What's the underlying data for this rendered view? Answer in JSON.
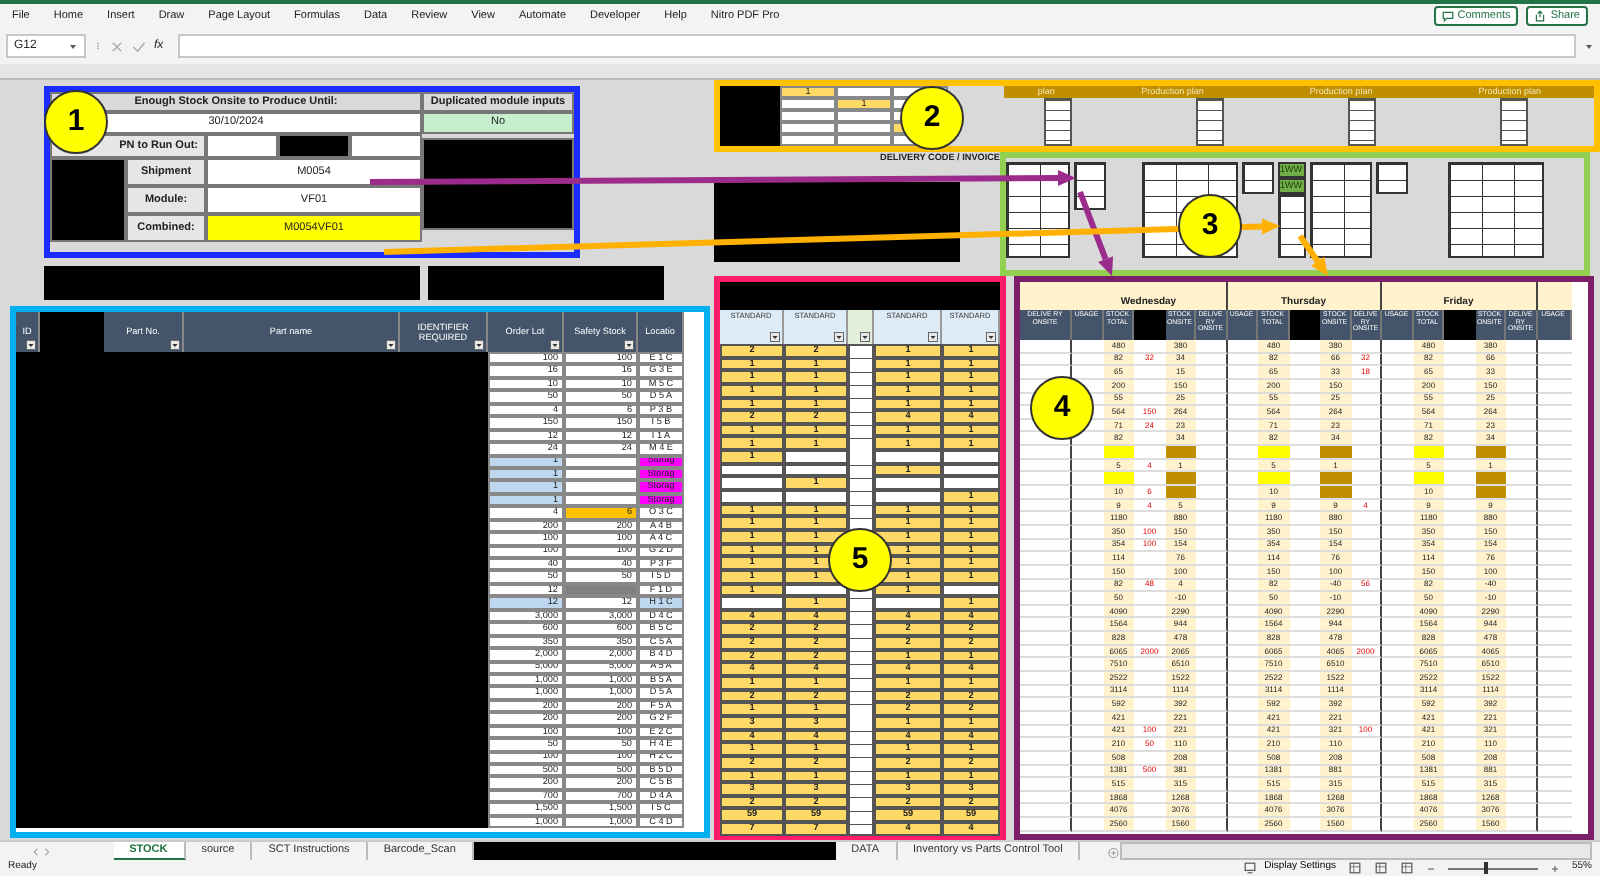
{
  "menu": [
    "File",
    "Home",
    "Insert",
    "Draw",
    "Page Layout",
    "Formulas",
    "Data",
    "Review",
    "View",
    "Automate",
    "Developer",
    "Help",
    "Nitro PDF Pro"
  ],
  "header_buttons": [
    "Comments",
    "Share"
  ],
  "formula_bar": {
    "name_box": "G12",
    "fx": "fx"
  },
  "summary": {
    "title": "Enough Stock Onsite to Produce Until:",
    "date": "30/10/2024",
    "dup_title": "Duplicated module inputs",
    "dup_value": "No",
    "run_out_label": "PN to Run Out:",
    "fields": [
      {
        "label": "Shipment",
        "value": "M0054",
        "highlight": false
      },
      {
        "label": "Module:",
        "value": "VF01",
        "highlight": false
      },
      {
        "label": "Combined:",
        "value": "M0054VF01",
        "highlight": true
      }
    ]
  },
  "plan": {
    "mini_grid": [
      [
        {
          "filled": true,
          "text": "1"
        },
        {
          "filled": false
        },
        {
          "filled": false
        }
      ],
      [
        {
          "filled": false
        },
        {
          "filled": true,
          "text": "1"
        },
        {
          "filled": false
        }
      ],
      [
        {
          "filled": false
        },
        {
          "filled": false
        },
        {
          "filled": false
        }
      ],
      [
        {
          "filled": false
        },
        {
          "filled": false
        },
        {
          "filled": true
        }
      ],
      [
        {
          "filled": false
        },
        {
          "filled": false
        },
        {
          "filled": false
        }
      ]
    ],
    "headers": [
      "plan",
      "Production plan",
      "Production plan",
      "Production plan"
    ]
  },
  "delivery_code_label": "DELIVERY CODE / INVOICE",
  "allocation": {
    "tags": [
      "1WW",
      "1WW"
    ]
  },
  "stock_table": {
    "columns": [
      {
        "kind": "header",
        "label": "ID",
        "filter": true
      },
      {
        "kind": "redacted",
        "filter": false
      },
      {
        "kind": "header",
        "label": "Part No.",
        "filter": true
      },
      {
        "kind": "header",
        "label": "Part name",
        "filter": true
      },
      {
        "kind": "header",
        "label": "IDENTIFIER REQUIRED",
        "filter": true
      },
      {
        "kind": "header",
        "label": "Order Lot",
        "filter": true
      },
      {
        "kind": "header",
        "label": "Safety Stock",
        "filter": true
      },
      {
        "kind": "header",
        "label": "Locatio",
        "filter": false
      }
    ],
    "rows": [
      [
        "100",
        "100",
        "E 1 C"
      ],
      [
        "16",
        "16",
        "G 3 E"
      ],
      [
        "10",
        "10",
        "M 5 C"
      ],
      [
        "50",
        "50",
        "D 5 A"
      ],
      [
        "4",
        "6",
        "P 3 B"
      ],
      [
        "150",
        "150",
        "I 5 B"
      ],
      [
        "12",
        "12",
        "I 1 A"
      ],
      [
        "24",
        "24",
        "M 4 E"
      ],
      [
        {
          "text": "1",
          "color": "#bdd7ee"
        },
        "",
        {
          "text": "Storag",
          "color": "#ff00ff"
        }
      ],
      [
        {
          "text": "1",
          "color": "#bdd7ee"
        },
        "",
        {
          "text": "Storag",
          "color": "#ff00ff"
        }
      ],
      [
        {
          "text": "1",
          "color": "#bdd7ee"
        },
        "",
        {
          "text": "Storag",
          "color": "#ff00ff"
        }
      ],
      [
        {
          "text": "1",
          "color": "#bdd7ee"
        },
        "",
        {
          "text": "Storag",
          "color": "#ff00ff"
        }
      ],
      [
        "4",
        {
          "text": "6",
          "color": "#ffc000"
        },
        "O 3 C"
      ],
      [
        "200",
        "200",
        "A 4 B"
      ],
      [
        "100",
        "100",
        "A 4 C"
      ],
      [
        "100",
        "100",
        "G 2 D"
      ],
      [
        "40",
        "40",
        "P 3 F"
      ],
      [
        "50",
        "50",
        "I 5 D"
      ],
      [
        "12",
        {
          "text": "",
          "color": "#808080"
        },
        "F 1 D"
      ],
      [
        {
          "text": "12",
          "color": "#bdd7ee"
        },
        "12",
        {
          "text": "H 1 C",
          "color": "#bdd7ee"
        }
      ],
      [
        "3,000",
        "3,000",
        "D 4 C"
      ],
      [
        "600",
        "600",
        "B 5 C"
      ],
      [
        "350",
        "350",
        "C 5 A"
      ],
      [
        "2,000",
        "2,000",
        "B 4 D"
      ],
      [
        "5,000",
        "5,000",
        "A 5 A"
      ],
      [
        "1,000",
        "1,000",
        "B 5 A"
      ],
      [
        "1,000",
        "1,000",
        "D 5 A"
      ],
      [
        "200",
        "200",
        "F 5 A"
      ],
      [
        "200",
        "200",
        "G 2 F"
      ],
      [
        "100",
        "100",
        "E 2 C"
      ],
      [
        "50",
        "50",
        "H 4 E"
      ],
      [
        "100",
        "100",
        "H 2 C"
      ],
      [
        "500",
        "500",
        "B 5 D"
      ],
      [
        "200",
        "200",
        "C 5 B"
      ],
      [
        "700",
        "700",
        "D 4 A"
      ],
      [
        "1,500",
        "1,500",
        "I 5 C"
      ],
      [
        "1,000",
        "1,000",
        "C 4 D"
      ]
    ]
  },
  "standard_table": {
    "columns": [
      {
        "kind": "header",
        "label": "STANDARD"
      },
      {
        "kind": "header",
        "label": "STANDARD"
      },
      {
        "kind": "blank"
      },
      {
        "kind": "header",
        "label": "STANDARD"
      },
      {
        "kind": "header",
        "label": "STANDARD"
      }
    ],
    "rows": [
      [
        "2",
        "2",
        "",
        "1",
        "1"
      ],
      [
        "1",
        "1",
        "",
        "1",
        "1"
      ],
      [
        "1",
        "1",
        "",
        "1",
        "1"
      ],
      [
        "1",
        "1",
        "",
        "1",
        "1"
      ],
      [
        "1",
        "1",
        "",
        "1",
        "1"
      ],
      [
        "2",
        "2",
        "",
        "4",
        "4"
      ],
      [
        "1",
        "1",
        "",
        "1",
        "1"
      ],
      [
        "1",
        "1",
        "",
        "1",
        "1"
      ],
      [
        "1",
        "",
        "",
        "",
        ""
      ],
      [
        "",
        "",
        "",
        "1",
        ""
      ],
      [
        "",
        "1",
        "",
        "",
        ""
      ],
      [
        "",
        "",
        "",
        "",
        "1"
      ],
      [
        "1",
        "1",
        "",
        "1",
        "1"
      ],
      [
        "1",
        "1",
        "",
        "1",
        "1"
      ],
      [
        "1",
        "1",
        "",
        "1",
        "1"
      ],
      [
        "1",
        "1",
        "",
        "1",
        "1"
      ],
      [
        "1",
        "1",
        "",
        "1",
        "1"
      ],
      [
        "1",
        "1",
        "",
        "1",
        "1"
      ],
      [
        "1",
        "",
        "",
        "1",
        ""
      ],
      [
        "",
        "1",
        "",
        "",
        "1"
      ],
      [
        "4",
        "4",
        "",
        "4",
        "4"
      ],
      [
        "2",
        "2",
        "",
        "2",
        "2"
      ],
      [
        "2",
        "2",
        "",
        "2",
        "2"
      ],
      [
        "2",
        "2",
        "",
        "1",
        "1"
      ],
      [
        "4",
        "4",
        "",
        "4",
        "4"
      ],
      [
        "1",
        "1",
        "",
        "1",
        "1"
      ],
      [
        "2",
        "2",
        "",
        "2",
        "2"
      ],
      [
        "1",
        "1",
        "",
        "2",
        "2"
      ],
      [
        "3",
        "3",
        "",
        "1",
        "1"
      ],
      [
        "4",
        "4",
        "",
        "4",
        "4"
      ],
      [
        "1",
        "1",
        "",
        "1",
        "1"
      ],
      [
        "2",
        "2",
        "",
        "2",
        "2"
      ],
      [
        "1",
        "1",
        "",
        "1",
        "1"
      ],
      [
        "3",
        "3",
        "",
        "3",
        "3"
      ],
      [
        "2",
        "2",
        "",
        "2",
        "2"
      ],
      [
        "59",
        "59",
        "",
        "59",
        "59"
      ],
      [
        "7",
        "7",
        "",
        "4",
        "4"
      ]
    ]
  },
  "schedule": {
    "lead_columns": [
      {
        "kind": "header",
        "label": "DELIVE RY ONSITE"
      }
    ],
    "days": [
      {
        "name": "Wednesday",
        "columns": [
          {
            "kind": "header",
            "label": "USAGE"
          },
          {
            "kind": "header",
            "label": "STOCK TOTAL"
          },
          {
            "kind": "redacted"
          },
          {
            "kind": "header",
            "label": "STOCK ONSITE"
          },
          {
            "kind": "header",
            "label": "DELIVE RY ONSITE"
          }
        ]
      },
      {
        "name": "Thursday",
        "columns": [
          {
            "kind": "header",
            "label": "USAGE"
          },
          {
            "kind": "header",
            "label": "STOCK TOTAL"
          },
          {
            "kind": "redacted"
          },
          {
            "kind": "header",
            "label": "STOCK ONSITE"
          },
          {
            "kind": "header",
            "label": "DELIVE RY ONSITE"
          }
        ]
      },
      {
        "name": "Friday",
        "columns": [
          {
            "kind": "header",
            "label": "USAGE"
          },
          {
            "kind": "header",
            "label": "STOCK TOTAL"
          },
          {
            "kind": "redacted"
          },
          {
            "kind": "header",
            "label": "STOCK ONSITE"
          },
          {
            "kind": "header",
            "label": "DELIVE RY ONSITE"
          }
        ]
      }
    ],
    "trail_columns": [
      {
        "kind": "header",
        "label": "USAGE"
      }
    ],
    "rows": [
      [
        "",
        "480",
        "",
        "380",
        "",
        "",
        "480",
        "",
        "380",
        "",
        "",
        "480",
        "",
        "380",
        ""
      ],
      [
        "",
        "82",
        "32",
        "34",
        "",
        "",
        "82",
        "",
        "66",
        "32",
        "",
        "82",
        "",
        "66",
        ""
      ],
      [
        "",
        "65",
        "",
        "15",
        "",
        "",
        "65",
        "",
        "33",
        "18",
        "",
        "65",
        "",
        "33",
        ""
      ],
      [
        "",
        "200",
        "",
        "150",
        "",
        "",
        "200",
        "",
        "150",
        "",
        "",
        "200",
        "",
        "150",
        ""
      ],
      [
        "",
        "55",
        "",
        "25",
        "",
        "",
        "55",
        "",
        "25",
        "",
        "",
        "55",
        "",
        "25",
        ""
      ],
      [
        "",
        "564",
        "150",
        "264",
        "",
        "",
        "564",
        "",
        "264",
        "",
        "",
        "564",
        "",
        "264",
        ""
      ],
      [
        "",
        "71",
        "24",
        "23",
        "",
        "",
        "71",
        "",
        "23",
        "",
        "",
        "71",
        "",
        "23",
        ""
      ],
      [
        "",
        "82",
        "",
        "34",
        "",
        "",
        "82",
        "",
        "34",
        "",
        "",
        "82",
        "",
        "34",
        ""
      ],
      [
        "",
        {
          "text": "",
          "color": "#ffff00"
        },
        "",
        {
          "text": "",
          "color": "#bf8f00"
        },
        "",
        "",
        {
          "text": "",
          "color": "#ffff00"
        },
        "",
        {
          "text": "",
          "color": "#bf8f00"
        },
        "",
        "",
        {
          "text": "",
          "color": "#ffff00"
        },
        "",
        {
          "text": "",
          "color": "#bf8f00"
        },
        ""
      ],
      [
        "",
        "5",
        "4",
        "1",
        "",
        "",
        "5",
        "",
        "1",
        "",
        "",
        "5",
        "",
        "1",
        ""
      ],
      [
        "",
        {
          "text": "",
          "color": "#ffff00"
        },
        "",
        {
          "text": "",
          "color": "#bf8f00"
        },
        "",
        "",
        {
          "text": "",
          "color": "#ffff00"
        },
        "",
        {
          "text": "",
          "color": "#bf8f00"
        },
        "",
        "",
        {
          "text": "",
          "color": "#ffff00"
        },
        "",
        {
          "text": "",
          "color": "#bf8f00"
        },
        ""
      ],
      [
        "",
        "10",
        "6",
        {
          "text": "",
          "color": "#bf8f00"
        },
        "",
        "",
        "10",
        "",
        {
          "text": "",
          "color": "#bf8f00"
        },
        "",
        "",
        "10",
        "",
        {
          "text": "",
          "color": "#bf8f00"
        },
        ""
      ],
      [
        "",
        "9",
        "4",
        "5",
        "",
        "",
        "9",
        "",
        "9",
        "4",
        "",
        "9",
        "",
        "9",
        ""
      ],
      [
        "",
        "1180",
        "",
        "880",
        "",
        "",
        "1180",
        "",
        "880",
        "",
        "",
        "1180",
        "",
        "880",
        ""
      ],
      [
        "",
        "350",
        "100",
        "150",
        "",
        "",
        "350",
        "",
        "150",
        "",
        "",
        "350",
        "",
        "150",
        ""
      ],
      [
        "",
        "354",
        "100",
        "154",
        "",
        "",
        "354",
        "",
        "154",
        "",
        "",
        "354",
        "",
        "154",
        ""
      ],
      [
        "",
        "114",
        "",
        "76",
        "",
        "",
        "114",
        "",
        "76",
        "",
        "",
        "114",
        "",
        "76",
        ""
      ],
      [
        "",
        "150",
        "",
        "100",
        "",
        "",
        "150",
        "",
        "100",
        "",
        "",
        "150",
        "",
        "100",
        ""
      ],
      [
        "",
        "82",
        "48",
        "4",
        "",
        "",
        "82",
        "",
        "-40",
        "56",
        "",
        "82",
        "",
        "-40",
        ""
      ],
      [
        "",
        "50",
        "",
        "-10",
        "",
        "",
        "50",
        "",
        "-10",
        "",
        "",
        "50",
        "",
        "-10",
        ""
      ],
      [
        "",
        "4090",
        "",
        "2290",
        "",
        "",
        "4090",
        "",
        "2290",
        "",
        "",
        "4090",
        "",
        "2290",
        ""
      ],
      [
        "",
        "1564",
        "",
        "944",
        "",
        "",
        "1564",
        "",
        "944",
        "",
        "",
        "1564",
        "",
        "944",
        ""
      ],
      [
        "",
        "828",
        "",
        "478",
        "",
        "",
        "828",
        "",
        "478",
        "",
        "",
        "828",
        "",
        "478",
        ""
      ],
      [
        "",
        "6065",
        "2000",
        "2065",
        "",
        "",
        "6065",
        "",
        "4065",
        "2000",
        "",
        "6065",
        "",
        "4065",
        ""
      ],
      [
        "",
        "7510",
        "",
        "6510",
        "",
        "",
        "7510",
        "",
        "6510",
        "",
        "",
        "7510",
        "",
        "6510",
        ""
      ],
      [
        "",
        "2522",
        "",
        "1522",
        "",
        "",
        "2522",
        "",
        "1522",
        "",
        "",
        "2522",
        "",
        "1522",
        ""
      ],
      [
        "",
        "3114",
        "",
        "1114",
        "",
        "",
        "3114",
        "",
        "1114",
        "",
        "",
        "3114",
        "",
        "1114",
        ""
      ],
      [
        "",
        "592",
        "",
        "392",
        "",
        "",
        "592",
        "",
        "392",
        "",
        "",
        "592",
        "",
        "392",
        ""
      ],
      [
        "",
        "421",
        "",
        "221",
        "",
        "",
        "421",
        "",
        "221",
        "",
        "",
        "421",
        "",
        "221",
        ""
      ],
      [
        "",
        "421",
        "100",
        "221",
        "",
        "",
        "421",
        "",
        "321",
        "100",
        "",
        "421",
        "",
        "321",
        ""
      ],
      [
        "",
        "210",
        "50",
        "110",
        "",
        "",
        "210",
        "",
        "110",
        "",
        "",
        "210",
        "",
        "110",
        ""
      ],
      [
        "",
        "508",
        "",
        "208",
        "",
        "",
        "508",
        "",
        "208",
        "",
        "",
        "508",
        "",
        "208",
        ""
      ],
      [
        "",
        "1381",
        "500",
        "381",
        "",
        "",
        "1381",
        "",
        "881",
        "",
        "",
        "1381",
        "",
        "881",
        ""
      ],
      [
        "",
        "515",
        "",
        "315",
        "",
        "",
        "515",
        "",
        "315",
        "",
        "",
        "515",
        "",
        "315",
        ""
      ],
      [
        "",
        "1868",
        "",
        "1268",
        "",
        "",
        "1868",
        "",
        "1268",
        "",
        "",
        "1868",
        "",
        "1268",
        ""
      ],
      [
        "",
        "4076",
        "",
        "3076",
        "",
        "",
        "4076",
        "",
        "3076",
        "",
        "",
        "4076",
        "",
        "3076",
        ""
      ],
      [
        "",
        "2560",
        "",
        "1560",
        "",
        "",
        "2560",
        "",
        "1560",
        "",
        "",
        "2560",
        "",
        "1560",
        ""
      ]
    ]
  },
  "callouts": [
    "1",
    "2",
    "3",
    "4",
    "5"
  ],
  "sheet_tabs": [
    {
      "kind": "tab",
      "label": "STOCK",
      "selected": true
    },
    {
      "kind": "tab",
      "label": "source",
      "selected": false
    },
    {
      "kind": "tab",
      "label": "SCT Instructions",
      "selected": false
    },
    {
      "kind": "tab",
      "label": "Barcode_Scan",
      "selected": false
    },
    {
      "kind": "redacted",
      "selected": false
    },
    {
      "kind": "tab",
      "label": "DATA",
      "selected": false
    },
    {
      "kind": "tab",
      "label": "Inventory vs Parts Control Tool",
      "selected": false
    }
  ],
  "status_bar": {
    "text": "Ready",
    "display_settings": "Display Settings",
    "zoom": "55%",
    "zoom_slider": {
      "level": 0.4
    }
  }
}
